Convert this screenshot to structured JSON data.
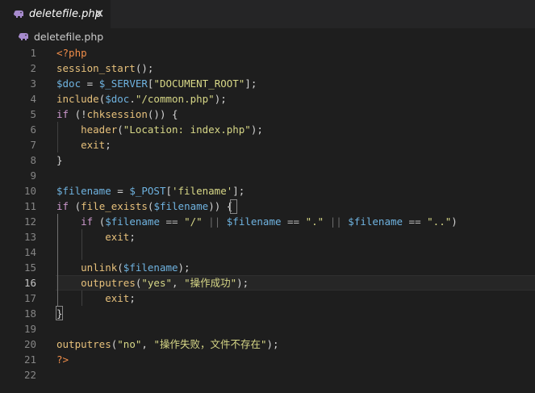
{
  "tab": {
    "label": "deletefile.php",
    "close_glyph": "✕",
    "icon": "php-elephant-icon"
  },
  "breadcrumb": {
    "label": "deletefile.php",
    "icon": "php-elephant-icon"
  },
  "editor": {
    "active_line": 16,
    "lines": [
      {
        "n": "1",
        "tokens": [
          [
            "t-tag",
            "<?php"
          ]
        ]
      },
      {
        "n": "2",
        "tokens": [
          [
            "t-fn",
            "session_start"
          ],
          [
            "t-def",
            "();"
          ]
        ]
      },
      {
        "n": "3",
        "tokens": [
          [
            "t-var",
            "$doc"
          ],
          [
            "t-def",
            " = "
          ],
          [
            "t-var",
            "$_SERVER"
          ],
          [
            "t-def",
            "["
          ],
          [
            "t-str",
            "\"DOCUMENT_ROOT\""
          ],
          [
            "t-def",
            "];"
          ]
        ]
      },
      {
        "n": "4",
        "tokens": [
          [
            "t-fn",
            "include"
          ],
          [
            "t-def",
            "("
          ],
          [
            "t-var",
            "$doc"
          ],
          [
            "t-def",
            "."
          ],
          [
            "t-str",
            "\"/common.php\""
          ],
          [
            "t-def",
            ");"
          ]
        ]
      },
      {
        "n": "5",
        "tokens": [
          [
            "t-kw",
            "if"
          ],
          [
            "t-def",
            " (!"
          ],
          [
            "t-fn",
            "chksession"
          ],
          [
            "t-def",
            "()) {"
          ]
        ]
      },
      {
        "n": "6",
        "tokens": [
          [
            "t-def",
            "    "
          ],
          [
            "t-fn",
            "header"
          ],
          [
            "t-def",
            "("
          ],
          [
            "t-str",
            "\"Location: index.php\""
          ],
          [
            "t-def",
            ");"
          ]
        ]
      },
      {
        "n": "7",
        "tokens": [
          [
            "t-def",
            "    "
          ],
          [
            "t-fn",
            "exit"
          ],
          [
            "t-def",
            ";"
          ]
        ]
      },
      {
        "n": "8",
        "tokens": [
          [
            "t-def",
            "}"
          ]
        ]
      },
      {
        "n": "9",
        "tokens": []
      },
      {
        "n": "10",
        "tokens": [
          [
            "t-var",
            "$filename"
          ],
          [
            "t-def",
            " = "
          ],
          [
            "t-var",
            "$_POST"
          ],
          [
            "t-def",
            "["
          ],
          [
            "t-str",
            "'filename'"
          ],
          [
            "t-def",
            "];"
          ]
        ]
      },
      {
        "n": "11",
        "tokens": [
          [
            "t-kw",
            "if"
          ],
          [
            "t-def",
            " ("
          ],
          [
            "t-fn",
            "file_exists"
          ],
          [
            "t-def",
            "("
          ],
          [
            "t-var",
            "$filename"
          ],
          [
            "t-def",
            ")) {"
          ]
        ]
      },
      {
        "n": "12",
        "tokens": [
          [
            "t-def",
            "    "
          ],
          [
            "t-kw",
            "if"
          ],
          [
            "t-def",
            " ("
          ],
          [
            "t-var",
            "$filename"
          ],
          [
            "t-op",
            " == "
          ],
          [
            "t-str",
            "\"/\""
          ],
          [
            "t-dim",
            " || "
          ],
          [
            "t-var",
            "$filename"
          ],
          [
            "t-op",
            " == "
          ],
          [
            "t-str",
            "\".\""
          ],
          [
            "t-dim",
            " || "
          ],
          [
            "t-var",
            "$filename"
          ],
          [
            "t-op",
            " == "
          ],
          [
            "t-str",
            "\"..\""
          ],
          [
            "t-def",
            ")"
          ]
        ]
      },
      {
        "n": "13",
        "tokens": [
          [
            "t-def",
            "        "
          ],
          [
            "t-fn",
            "exit"
          ],
          [
            "t-def",
            ";"
          ]
        ]
      },
      {
        "n": "14",
        "tokens": []
      },
      {
        "n": "15",
        "tokens": [
          [
            "t-def",
            "    "
          ],
          [
            "t-fn",
            "unlink"
          ],
          [
            "t-def",
            "("
          ],
          [
            "t-var",
            "$filename"
          ],
          [
            "t-def",
            ");"
          ]
        ]
      },
      {
        "n": "16",
        "tokens": [
          [
            "t-def",
            "    "
          ],
          [
            "t-fn",
            "outputres"
          ],
          [
            "t-def",
            "("
          ],
          [
            "t-str",
            "\"yes\""
          ],
          [
            "t-def",
            ", "
          ],
          [
            "t-str",
            "\"操作成功\""
          ],
          [
            "t-def",
            ");"
          ]
        ]
      },
      {
        "n": "17",
        "tokens": [
          [
            "t-def",
            "        "
          ],
          [
            "t-fn",
            "exit"
          ],
          [
            "t-def",
            ";"
          ]
        ]
      },
      {
        "n": "18",
        "tokens": [
          [
            "t-def",
            "}"
          ]
        ]
      },
      {
        "n": "19",
        "tokens": []
      },
      {
        "n": "20",
        "tokens": [
          [
            "t-fn",
            "outputres"
          ],
          [
            "t-def",
            "("
          ],
          [
            "t-str",
            "\"no\""
          ],
          [
            "t-def",
            ", "
          ],
          [
            "t-str",
            "\"操作失败，文件不存在\""
          ],
          [
            "t-def",
            ");"
          ]
        ]
      },
      {
        "n": "21",
        "tokens": [
          [
            "t-tag",
            "?>"
          ]
        ]
      },
      {
        "n": "22",
        "tokens": []
      }
    ]
  }
}
